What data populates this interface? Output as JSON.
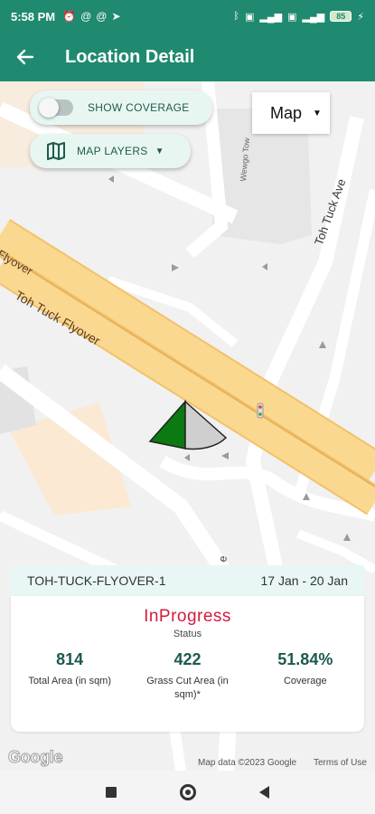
{
  "status_bar": {
    "time": "5:58 PM",
    "left_icons": [
      "alarm-icon",
      "at-icon",
      "at-icon",
      "telegram-icon"
    ],
    "right_icons": [
      "bluetooth-icon",
      "volte-icon",
      "signal-icon",
      "volte-icon",
      "signal-icon"
    ],
    "battery": "85"
  },
  "app_bar": {
    "title": "Location Detail",
    "back_icon": "arrow-left-icon"
  },
  "map_controls": {
    "coverage_toggle_label": "SHOW COVERAGE",
    "coverage_on": false,
    "layers_label": "MAP LAYERS",
    "map_type_selected": "Map"
  },
  "map_labels": {
    "flyover": "Flyover",
    "toh_tuck_flyover": "Toh Tuck Flyover",
    "toh_tuck_ave": "Toh Tuck Ave",
    "wewgo": "Wewgo Tow",
    "road_e": "e"
  },
  "location": {
    "name": "TOH-TUCK-FLYOVER-1",
    "dates": "17 Jan - 20 Jan",
    "status": "InProgress",
    "status_label": "Status",
    "stats": [
      {
        "value": "814",
        "label": "Total Area (in sqm)"
      },
      {
        "value": "422",
        "label": "Grass Cut Area (in sqm)*"
      },
      {
        "value": "51.84%",
        "label": "Coverage"
      }
    ]
  },
  "map_footer": {
    "google": "Google",
    "attribution": "Map data ©2023 Google",
    "terms": "Terms of Use"
  },
  "colors": {
    "primary": "#1f8a6f",
    "status": "#d51b3b",
    "covered": "#0b7a12",
    "uncovered": "#cfcfcf"
  }
}
